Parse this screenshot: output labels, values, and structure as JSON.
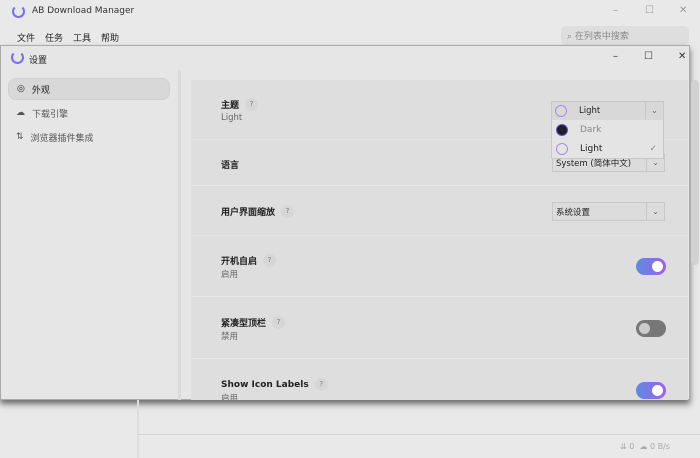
{
  "app": {
    "title": "AB Download Manager",
    "menu": [
      "文件",
      "任务",
      "工具",
      "帮助"
    ],
    "search_placeholder": "在列表中搜索"
  },
  "dialog": {
    "title": "设置",
    "sidebar": [
      {
        "label": "外观",
        "icon": "palette-icon"
      },
      {
        "label": "下载引擎",
        "icon": "cloud-download-icon"
      },
      {
        "label": "浏览器插件集成",
        "icon": "sort-arrows-icon"
      }
    ],
    "rows": [
      {
        "title": "主题",
        "subtitle": "Light"
      },
      {
        "title": "语言",
        "value": "System (简体中文)"
      },
      {
        "title": "用户界面缩放",
        "value": "系统设置"
      },
      {
        "title": "开机自启",
        "subtitle": "启用",
        "on": true
      },
      {
        "title": "紧凑型顶栏",
        "subtitle": "禁用",
        "on": false
      },
      {
        "title": "Show Icon Labels",
        "subtitle": "启用",
        "on": true
      }
    ],
    "theme_select": {
      "value": "Light",
      "options": [
        "Dark",
        "Light"
      ],
      "selected": "Light"
    }
  },
  "status": {
    "down": "0",
    "up": "0",
    "unit": "B/s"
  },
  "help": "?"
}
